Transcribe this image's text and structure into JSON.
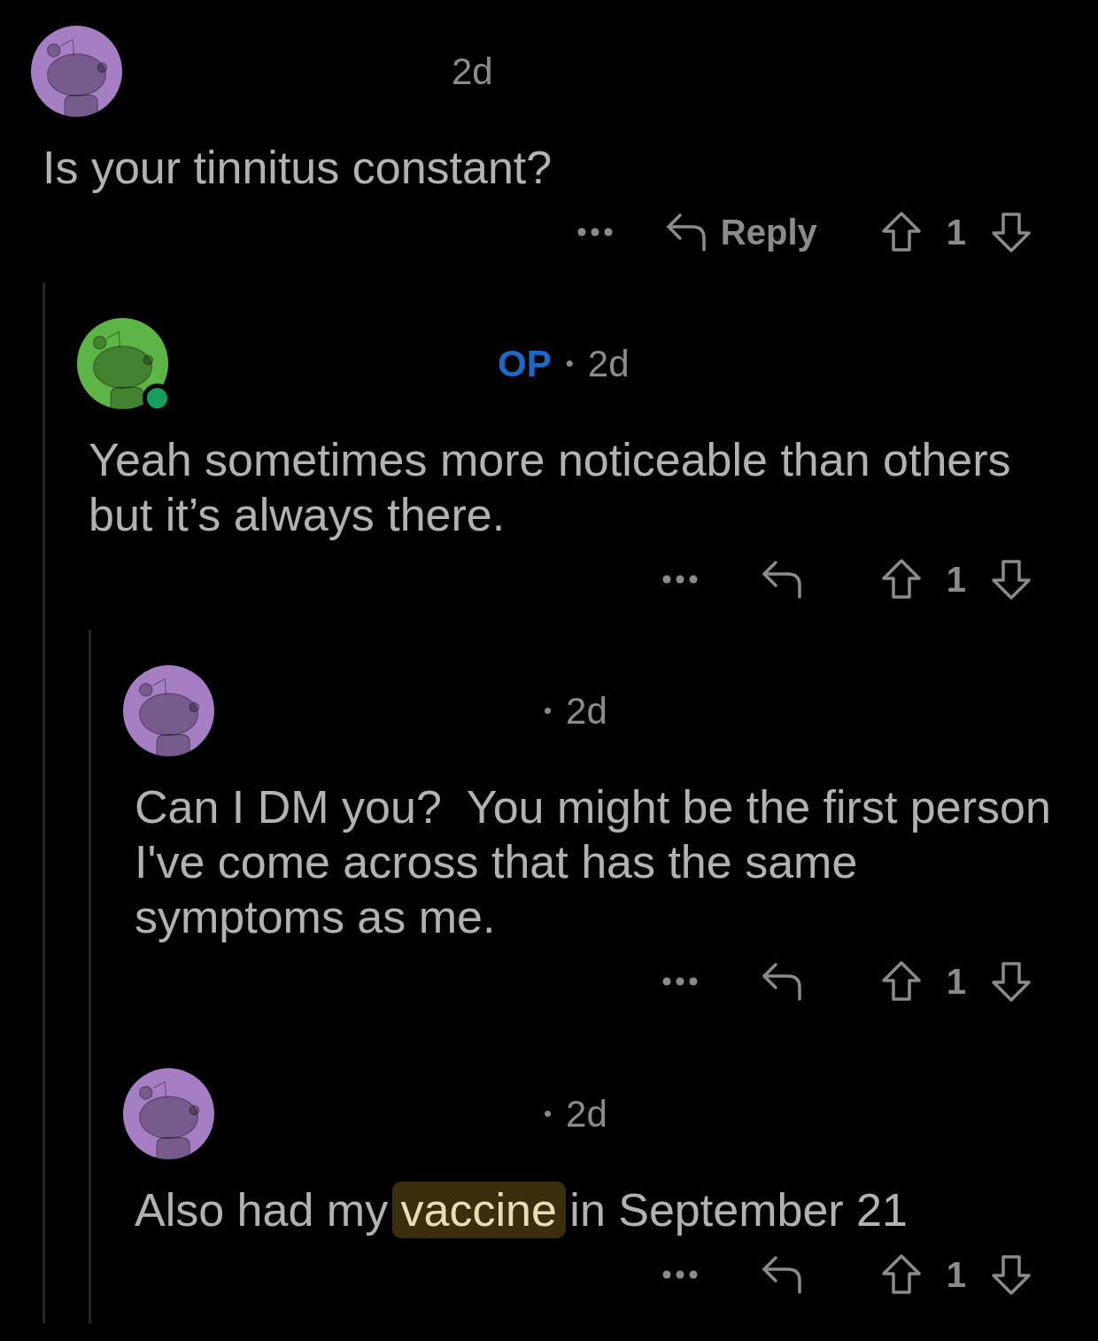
{
  "comments": [
    {
      "color": "#a67ec4",
      "online": false,
      "time": "2d",
      "body": [
        {
          "text": "Is your tinnitus constant?",
          "highlighted": false
        }
      ],
      "reply_label": "Reply",
      "score": "1",
      "children": [
        {
          "color": "#5db545",
          "online": true,
          "badge": "OP",
          "separator": "•",
          "time": "2d",
          "body": [
            {
              "text": "Yeah sometimes more noticeable than others but it’s always there.",
              "highlighted": false
            }
          ],
          "score": "1",
          "children": [
            {
              "color": "#a67ec4",
              "online": false,
              "separator": "•",
              "time": "2d",
              "body": [
                {
                  "text": "Can I DM you?  You might be the first person I've come across that has the same symptoms as me.",
                  "highlighted": false
                }
              ],
              "score": "1"
            },
            {
              "color": "#a67ec4",
              "online": false,
              "separator": "•",
              "time": "2d",
              "body": [
                {
                  "text": "Also had my ",
                  "highlighted": false
                },
                {
                  "text": "vaccine",
                  "highlighted": true
                },
                {
                  "text": " in September 21",
                  "highlighted": false
                }
              ],
              "score": "1"
            }
          ]
        }
      ]
    }
  ]
}
